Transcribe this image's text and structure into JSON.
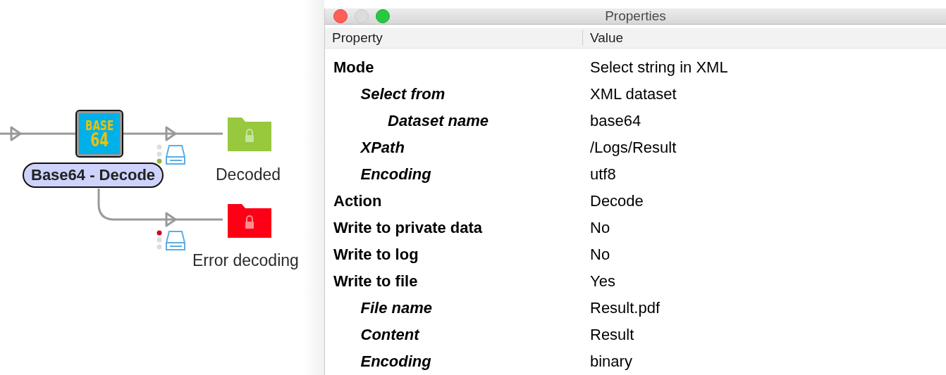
{
  "flow": {
    "node": {
      "logo_text": [
        "BASE",
        "64"
      ],
      "label": "Base64 - Decode"
    },
    "outputs": [
      {
        "label": "Decoded",
        "color": "#97c83e",
        "error": false
      },
      {
        "label": "Error decoding",
        "color": "#fe0015",
        "error": true
      }
    ]
  },
  "properties_window": {
    "title": "Properties",
    "columns": [
      "Property",
      "Value"
    ],
    "rows": [
      {
        "name": "Mode",
        "value": "Select string in XML",
        "children": [
          {
            "name": "Select from",
            "value": "XML dataset",
            "children": [
              {
                "name": "Dataset name",
                "value": "base64"
              }
            ]
          },
          {
            "name": "XPath",
            "value": "/Logs/Result"
          },
          {
            "name": "Encoding",
            "value": "utf8"
          }
        ]
      },
      {
        "name": "Action",
        "value": "Decode"
      },
      {
        "name": "Write to private data",
        "value": "No"
      },
      {
        "name": "Write to log",
        "value": "No"
      },
      {
        "name": "Write to file",
        "value": "Yes",
        "children": [
          {
            "name": "File name",
            "value": "Result.pdf"
          },
          {
            "name": "Content",
            "value": "Result"
          },
          {
            "name": "Encoding",
            "value": "binary"
          }
        ]
      }
    ]
  }
}
